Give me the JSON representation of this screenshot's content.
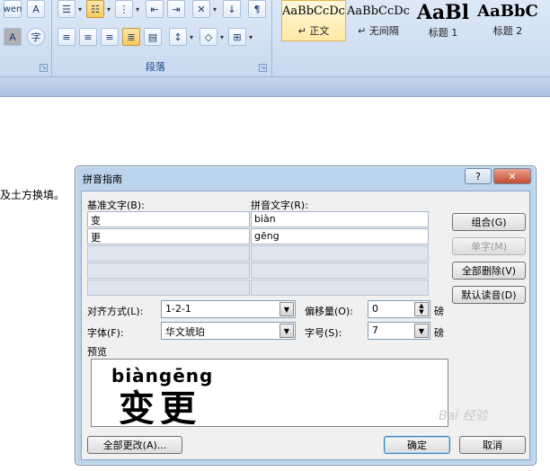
{
  "ribbon": {
    "font_icons": [
      "wen",
      "A"
    ],
    "char_border_icon": "A",
    "enclose_icon": "字",
    "paragraph_group_label": "段落",
    "styles": [
      {
        "sample": "AaBbCcDc",
        "name": "↵ 正文",
        "selected": true
      },
      {
        "sample": "AaBbCcDc",
        "name": "↵ 无间隔",
        "selected": false
      },
      {
        "sample": "AaBl",
        "name": "标题 1",
        "selected": false
      },
      {
        "sample": "AaBbC",
        "name": "标题 2",
        "selected": false
      }
    ]
  },
  "document": {
    "visible_text": "及土方换填。"
  },
  "dialog": {
    "title": "拼音指南",
    "help_label": "?",
    "close_label": "✕",
    "base_text_label": "基准文字(B):",
    "ruby_text_label": "拼音文字(R):",
    "rows": [
      {
        "base": "变",
        "ruby": "biàn"
      },
      {
        "base": "更",
        "ruby": "gēng"
      }
    ],
    "buttons": {
      "group": "组合(G)",
      "mono": "单字(M)",
      "clear_all": "全部删除(V)",
      "default_reading": "默认读音(D)",
      "apply_all": "全部更改(A)...",
      "ok": "确定",
      "cancel": "取消"
    },
    "alignment_label": "对齐方式(L):",
    "alignment_value": "1-2-1",
    "offset_label": "偏移量(O):",
    "offset_value": "0",
    "offset_unit": "磅",
    "font_label": "字体(F):",
    "font_value": "华文琥珀",
    "size_label": "字号(S):",
    "size_value": "7",
    "size_unit": "磅",
    "preview_label": "预览",
    "preview_pinyin": "biàngēng",
    "preview_chars": "变更"
  },
  "watermark": "Bai 经验"
}
